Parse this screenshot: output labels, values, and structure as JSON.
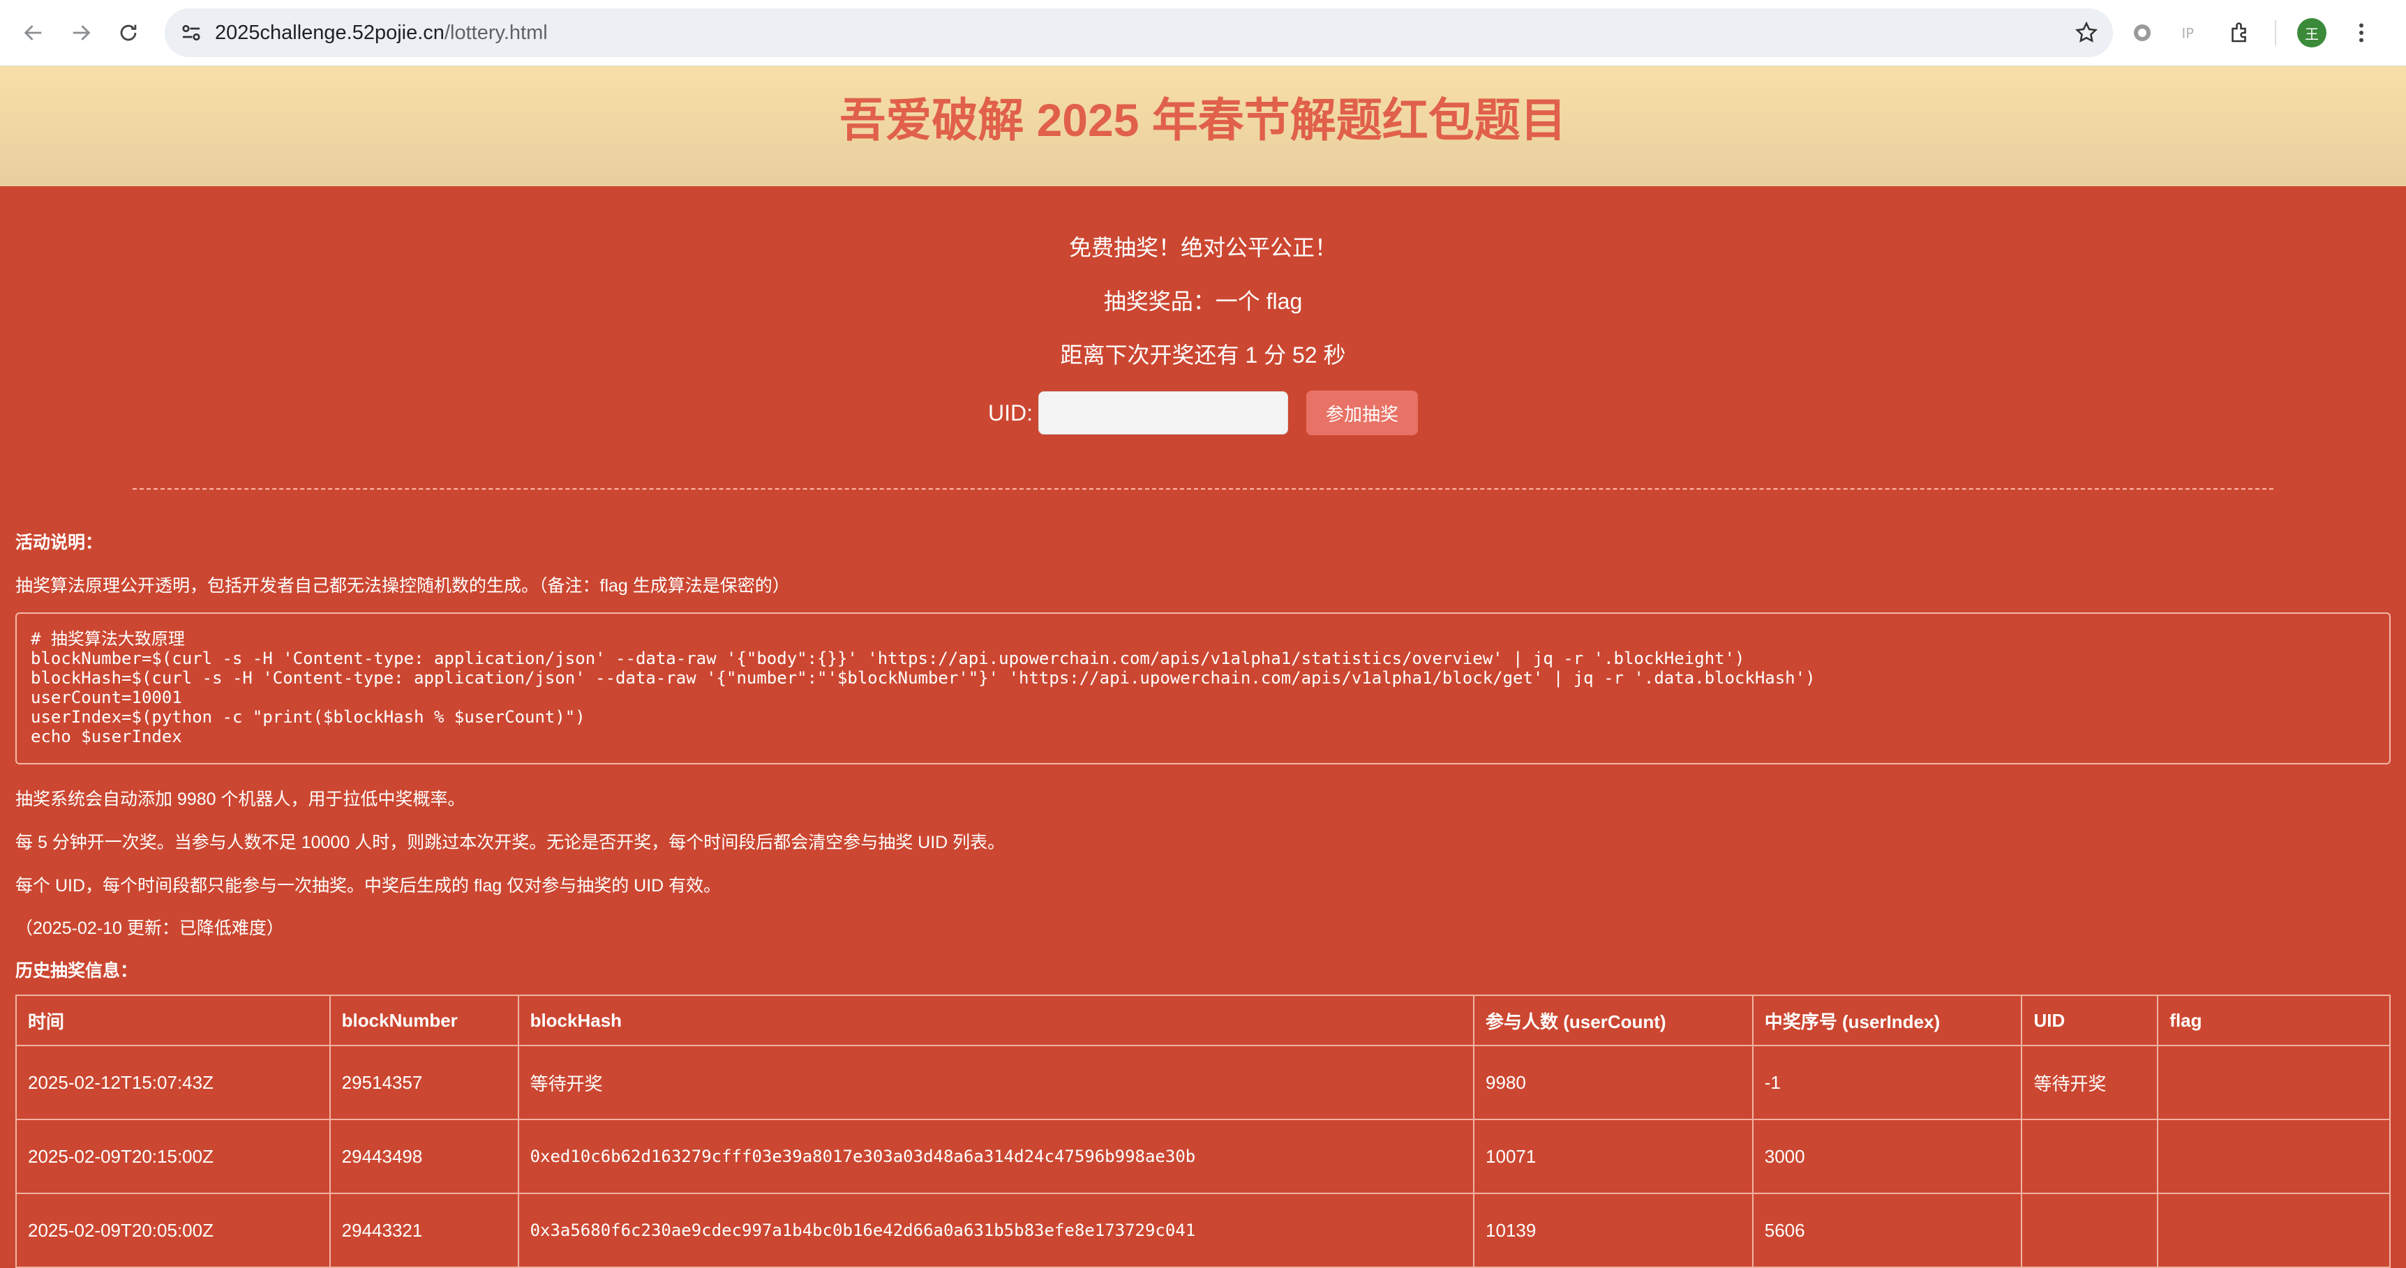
{
  "browser": {
    "url_host": "2025challenge.52pojie.cn",
    "url_path": "/lottery.html",
    "avatar_letter": "王"
  },
  "page": {
    "title": "吾爱破解 2025 年春节解题红包题目",
    "line1": "免费抽奖！绝对公平公正！",
    "line2": "抽奖奖品：一个 flag",
    "line3": "距离下次开奖还有 1 分 52 秒",
    "uid_label": "UID:",
    "uid_value": "",
    "join_button": "参加抽奖",
    "section_rules": "活动说明：",
    "rules_intro": "抽奖算法原理公开透明，包括开发者自己都无法操控随机数的生成。（备注：flag 生成算法是保密的）",
    "code": "# 抽奖算法大致原理\nblockNumber=$(curl -s -H 'Content-type: application/json' --data-raw '{\"body\":{}}' 'https://api.upowerchain.com/apis/v1alpha1/statistics/overview' | jq -r '.blockHeight')\nblockHash=$(curl -s -H 'Content-type: application/json' --data-raw '{\"number\":\"'$blockNumber'\"}' 'https://api.upowerchain.com/apis/v1alpha1/block/get' | jq -r '.data.blockHash')\nuserCount=10001\nuserIndex=$(python -c \"print($blockHash % $userCount)\")\necho $userIndex",
    "note1": "抽奖系统会自动添加 9980 个机器人，用于拉低中奖概率。",
    "note2": "每 5 分钟开一次奖。当参与人数不足 10000 人时，则跳过本次开奖。无论是否开奖，每个时间段后都会清空参与抽奖 UID 列表。",
    "note3": "每个 UID，每个时间段都只能参与一次抽奖。中奖后生成的 flag 仅对参与抽奖的 UID 有效。",
    "note4": "（2025-02-10 更新：已降低难度）",
    "section_history": "历史抽奖信息："
  },
  "table": {
    "headers": [
      "时间",
      "blockNumber",
      "blockHash",
      "参与人数 (userCount)",
      "中奖序号 (userIndex)",
      "UID",
      "flag"
    ],
    "rows": [
      [
        "2025-02-12T15:07:43Z",
        "29514357",
        "等待开奖",
        "9980",
        "-1",
        "等待开奖",
        ""
      ],
      [
        "2025-02-09T20:15:00Z",
        "29443498",
        "0xed10c6b62d163279cfff03e39a8017e303a03d48a6a314d24c47596b998ae30b",
        "10071",
        "3000",
        "",
        ""
      ],
      [
        "2025-02-09T20:05:00Z",
        "29443321",
        "0x3a5680f6c230ae9cdec997a1b4bc0b16e42d66a0a631b5b83efe8e173729c041",
        "10139",
        "5606",
        "",
        ""
      ]
    ]
  }
}
